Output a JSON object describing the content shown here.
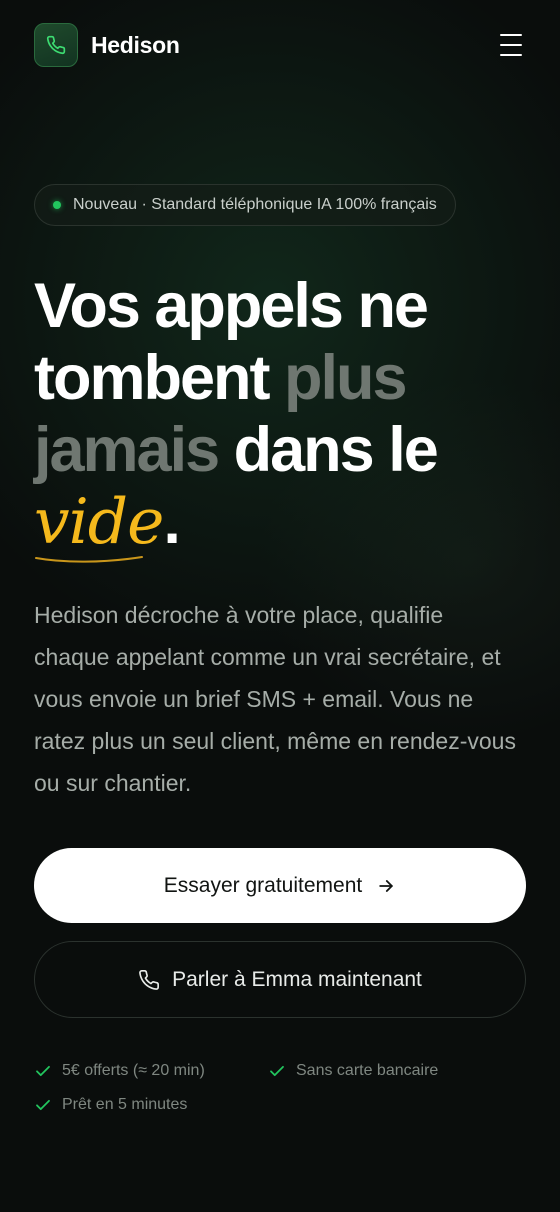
{
  "header": {
    "brand_name": "Hedison",
    "logo_icon": "phone-icon",
    "menu_icon": "hamburger-menu-icon"
  },
  "badge": {
    "text": "Nouveau · Standard téléphonique IA 100% français",
    "dot_color": "#22c55e"
  },
  "headline": {
    "part1": "Vos appels ne tombent ",
    "part2_muted": "plus jamais",
    "part3": " dans le ",
    "part4_accent": "vide",
    "part5": "."
  },
  "lead": "Hedison décroche à votre place, qualifie chaque appelant comme un vrai secrétaire, et vous envoie un brief SMS + email. Vous ne ratez plus un seul client, même en rendez-vous ou sur chantier.",
  "cta": {
    "primary_label": "Essayer gratuitement",
    "primary_icon": "arrow-right-icon",
    "secondary_label": "Parler à Emma maintenant",
    "secondary_icon": "phone-icon"
  },
  "perks": [
    {
      "label": "5€ offerts (≈ 20 min)",
      "icon": "check-icon"
    },
    {
      "label": "Sans carte bancaire",
      "icon": "check-icon"
    },
    {
      "label": "Prêt en 5 minutes",
      "icon": "check-icon"
    }
  ],
  "colors": {
    "accent": "#f5b91c",
    "brand_green": "#22c55e",
    "background": "#0a0d0c"
  }
}
